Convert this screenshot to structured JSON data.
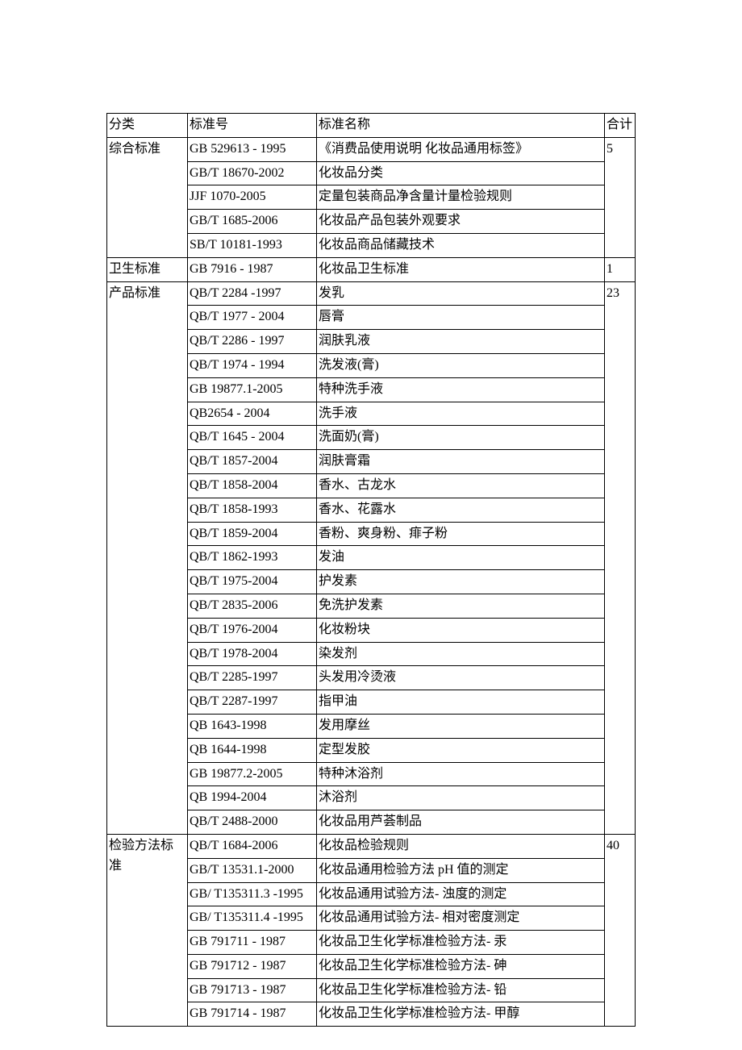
{
  "header": {
    "c1": "分类",
    "c2": "标准号",
    "c3": "标准名称",
    "c4": "合计"
  },
  "groups": [
    {
      "category": "综合标准",
      "total": "5",
      "rows": [
        {
          "code": "GB 529613 - 1995",
          "name": "《消费品使用说明 化妆品通用标签》"
        },
        {
          "code": "GB/T 18670-2002",
          "name": "化妆品分类"
        },
        {
          "code": "JJF 1070-2005",
          "name": "定量包装商品净含量计量检验规则"
        },
        {
          "code": "GB/T 1685-2006",
          "name": "化妆品产品包装外观要求"
        },
        {
          "code": "SB/T 10181-1993",
          "name": "化妆品商品储藏技术"
        }
      ]
    },
    {
      "category": "卫生标准",
      "total": "1",
      "rows": [
        {
          "code": "GB 7916 - 1987",
          "name": "化妆品卫生标准"
        }
      ]
    },
    {
      "category": "产品标准",
      "total": "23",
      "rows": [
        {
          "code": "QB/T 2284 -1997",
          "name": "发乳"
        },
        {
          "code": "QB/T 1977 - 2004",
          "name": "唇膏"
        },
        {
          "code": "QB/T 2286 - 1997",
          "name": "润肤乳液"
        },
        {
          "code": "QB/T 1974 - 1994",
          "name": "洗发液(膏)"
        },
        {
          "code": "GB 19877.1-2005",
          "name": "特种洗手液"
        },
        {
          "code": "QB2654 - 2004",
          "name": "洗手液"
        },
        {
          "code": "QB/T 1645 - 2004",
          "name": "洗面奶(膏)"
        },
        {
          "code": "QB/T 1857-2004",
          "name": "润肤膏霜"
        },
        {
          "code": "QB/T 1858-2004",
          "name": "香水、古龙水"
        },
        {
          "code": "QB/T 1858-1993",
          "name": "香水、花露水"
        },
        {
          "code": "QB/T 1859-2004",
          "name": "香粉、爽身粉、痱子粉"
        },
        {
          "code": "QB/T 1862-1993",
          "name": "发油"
        },
        {
          "code": "QB/T 1975-2004",
          "name": "护发素"
        },
        {
          "code": "QB/T 2835-2006",
          "name": "免洗护发素"
        },
        {
          "code": "QB/T 1976-2004",
          "name": "化妆粉块"
        },
        {
          "code": "QB/T 1978-2004",
          "name": "染发剂"
        },
        {
          "code": "QB/T 2285-1997",
          "name": "头发用冷烫液"
        },
        {
          "code": "QB/T 2287-1997",
          "name": "指甲油"
        },
        {
          "code": "QB 1643-1998",
          "name": "发用摩丝"
        },
        {
          "code": "QB 1644-1998",
          "name": "定型发胶"
        },
        {
          "code": "GB 19877.2-2005",
          "name": "特种沐浴剂"
        },
        {
          "code": "QB 1994-2004",
          "name": "沐浴剂"
        },
        {
          "code": "QB/T 2488-2000",
          "name": "化妆品用芦荟制品"
        }
      ]
    },
    {
      "category": "检验方法标准",
      "total": "40",
      "rows": [
        {
          "code": "QB/T 1684-2006",
          "name": "化妆品检验规则"
        },
        {
          "code": "GB/T 13531.1-2000",
          "name": "化妆品通用检验方法 pH 值的测定"
        },
        {
          "code": "GB/ T135311.3 -1995",
          "name": "化妆品通用试验方法- 浊度的测定"
        },
        {
          "code": "GB/ T135311.4 -1995",
          "name": "化妆品通用试验方法- 相对密度测定"
        },
        {
          "code": "GB 791711 - 1987",
          "name": "化妆品卫生化学标准检验方法- 汞"
        },
        {
          "code": "GB 791712 - 1987",
          "name": "化妆品卫生化学标准检验方法- 砷"
        },
        {
          "code": "GB 791713 - 1987",
          "name": "化妆品卫生化学标准检验方法- 铅"
        },
        {
          "code": "GB 791714 - 1987",
          "name": "化妆品卫生化学标准检验方法- 甲醇"
        }
      ]
    }
  ]
}
